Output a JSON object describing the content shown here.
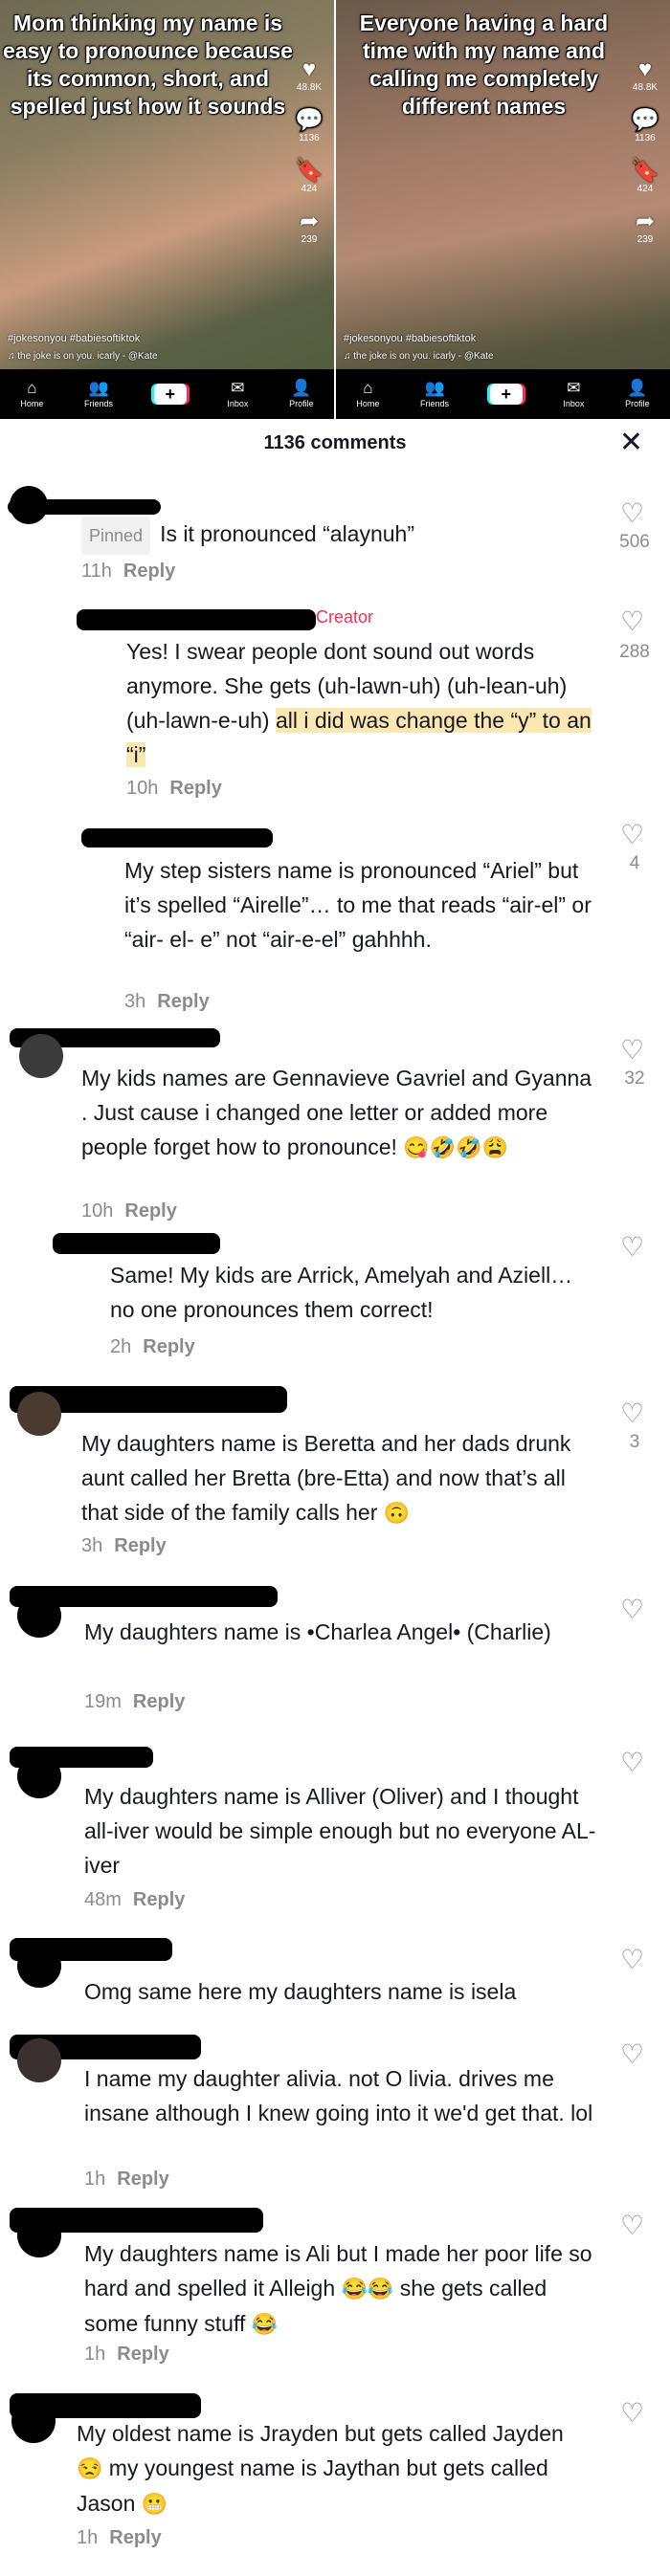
{
  "video_left": {
    "overlay": "Mom thinking my name is easy to pronounce because its common, short, and spelled just how it sounds",
    "likes": "48.8K",
    "comments": "1136",
    "saves": "424",
    "shares": "239",
    "caption": "#jokesonyou #babiesoftiktok",
    "music": "♫ the joke is on you. icarly - @Kate"
  },
  "video_right": {
    "overlay": "Everyone having a hard time with my name and calling me completely different names",
    "likes": "48.8K",
    "comments": "1136",
    "saves": "424",
    "shares": "239",
    "caption": "#jokesonyou #babiesoftiktok",
    "music": "♫ the joke is on you. icarly - @Kate"
  },
  "nav": {
    "home": "Home",
    "friends": "Friends",
    "inbox": "Inbox",
    "profile": "Profile"
  },
  "header": {
    "title": "1136 comments",
    "close": "✕"
  },
  "reply_label": "Reply",
  "comments": [
    {
      "pinned": "Pinned",
      "text": "Is it pronounced “alaynuh”",
      "time": "11h",
      "likes": "506"
    },
    {
      "creator": "Creator",
      "text_pre": "Yes! I swear people dont sound out words anymore. She gets (uh-lawn-uh) (uh-lean-uh) (uh-lawn-e-uh) ",
      "text_hl": "all i did was change the “y” to an “i”",
      "time": "10h",
      "likes": "288"
    },
    {
      "text": "My step sisters name is pronounced “Ariel” but it’s spelled “Airelle”… to me that reads “air-el” or “air- el- e” not “air-e-el” gahhhh.",
      "time": "3h",
      "likes": "4"
    },
    {
      "text": "My kids names are Gennavieve Gavriel and Gyanna . Just cause i changed one letter or added more people forget how to pronounce!",
      "emoji": "😋🤣🤣😩",
      "time": "10h",
      "likes": "32"
    },
    {
      "text": "Same! My kids are Arrick, Amelyah and Aziell…no one pronounces them correct!",
      "time": "2h",
      "likes": ""
    },
    {
      "text": "My daughters name is Beretta and her dads drunk aunt called her Bretta (bre-Etta) and now that’s all that side of the family calls her",
      "emoji": "🙃",
      "time": "3h",
      "likes": "3"
    },
    {
      "text": "My daughters name is •Charlea Angel• (Charlie)",
      "time": "19m",
      "likes": ""
    },
    {
      "text": "My daughters name is Alliver (Oliver) and I thought all-iver would be simple enough but no everyone AL-iver",
      "time": "48m",
      "likes": ""
    },
    {
      "text": "Omg same here my daughters name is isela",
      "time": "",
      "likes": ""
    },
    {
      "text": "I name my daughter alivia. not O livia. drives me insane although I knew going into it we'd get that. lol",
      "time": "1h",
      "likes": ""
    },
    {
      "text_pre": "My daughters name is Ali but I made her poor life so hard and spelled it Alleigh ",
      "emoji": "😂😂",
      "text_post": " she gets called some funny stuff ",
      "emoji2": "😂",
      "time": "1h",
      "likes": ""
    },
    {
      "text_pre": "My oldest name is Jrayden but gets called Jayden ",
      "emoji": "😒",
      "text_post": " my youngest name is Jaythan but gets called Jason ",
      "emoji2": "😬",
      "time": "1h",
      "likes": ""
    }
  ]
}
